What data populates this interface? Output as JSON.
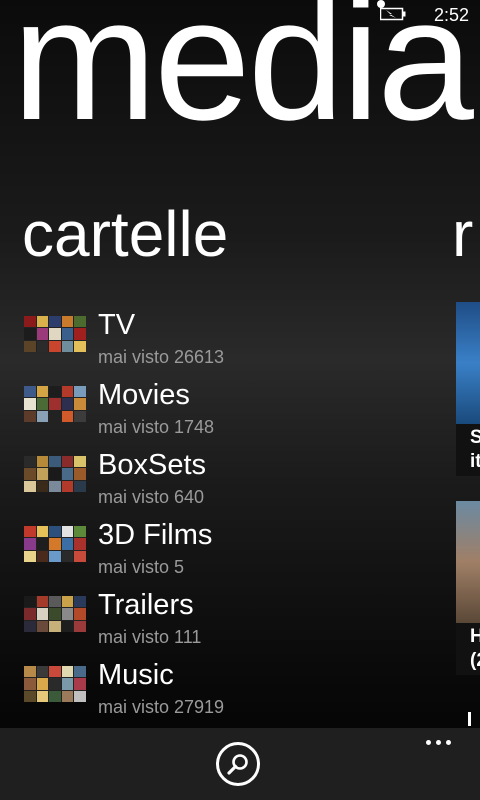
{
  "status_bar": {
    "time": "2:52",
    "battery_icon": "battery-charging-icon"
  },
  "panorama": {
    "title": "media"
  },
  "section": {
    "title": "cartelle",
    "next_title_peek": "r"
  },
  "folders": [
    {
      "name": "TV",
      "subtitle": "mai visto 26613"
    },
    {
      "name": "Movies",
      "subtitle": "mai visto 1748"
    },
    {
      "name": "BoxSets",
      "subtitle": "mai visto 640"
    },
    {
      "name": "3D Films",
      "subtitle": "mai visto 5"
    },
    {
      "name": "Trailers",
      "subtitle": "mai visto 111"
    },
    {
      "name": "Music",
      "subtitle": "mai visto 27919"
    }
  ],
  "peek_tiles": [
    {
      "line1": "S",
      "line2": "it"
    },
    {
      "line1": "H",
      "line2": "(2"
    }
  ],
  "app_bar": {
    "search_icon": "search-icon",
    "more_icon": "more-dots-icon"
  }
}
